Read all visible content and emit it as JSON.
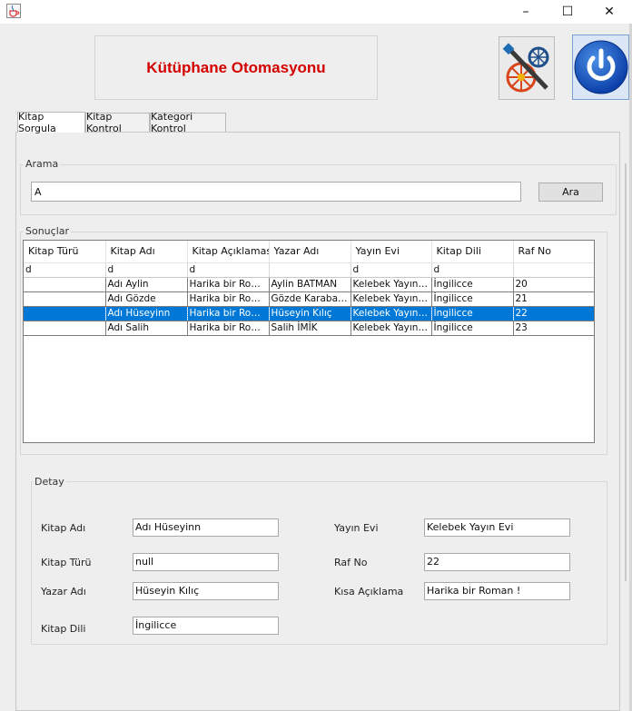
{
  "window": {
    "icon": "java-cup-icon",
    "controls": {
      "minimize": "–",
      "maximize": "☐",
      "close": "✕"
    }
  },
  "header": {
    "title": "Kütüphane Otomasyonu",
    "title_color": "#d40000",
    "tools_icon": "tools-wheel-icon",
    "power_icon": "power-icon"
  },
  "tabs": [
    {
      "label": "Kitap Sorgula",
      "active": true
    },
    {
      "label": "Kitap Kontrol",
      "active": false
    },
    {
      "label": "Kategori Kontrol",
      "active": false
    }
  ],
  "search": {
    "group_title": "Arama",
    "value": "A",
    "button_label": "Ara"
  },
  "results": {
    "group_title": "Sonuçlar",
    "columns": [
      "Kitap Türü",
      "Kitap Adı",
      "Kitap Açıklaması",
      "Yazar Adı",
      "Yayın Evi",
      "Kitap Dili",
      "Raf No"
    ],
    "filter_row": [
      "d",
      "d",
      "d",
      "",
      "d",
      "d",
      ""
    ],
    "rows": [
      {
        "cells": [
          "",
          "Adı Aylin",
          "Harika bir Roma...",
          "Aylin BATMAN",
          "Kelebek Yayın Evi",
          "İngilicce",
          "20"
        ],
        "selected": false
      },
      {
        "cells": [
          "",
          "Adı Gözde",
          "Harika bir Roma...",
          "Gözde Karabacak",
          "Kelebek Yayın Evi",
          "İngilicce",
          "21"
        ],
        "selected": false
      },
      {
        "cells": [
          "",
          "Adı Hüseyinn",
          "Harika bir Roma...",
          "Hüseyin Kılıç",
          "Kelebek Yayın Evi",
          "İngilicce",
          "22"
        ],
        "selected": true
      },
      {
        "cells": [
          "",
          "Adı Salih",
          "Harika bir Roma...",
          "Salih İMİK",
          "Kelebek Yayın Evi",
          "İngilicce",
          "23"
        ],
        "selected": false
      }
    ],
    "selection_color": "#0078d7"
  },
  "detail": {
    "group_title": "Detay",
    "kitap_adi": {
      "label": "Kitap Adı",
      "value": "Adı Hüseyinn"
    },
    "kitap_turu": {
      "label": "Kitap Türü",
      "value": "null"
    },
    "yazar_adi": {
      "label": "Yazar Adı",
      "value": "Hüseyin Kılıç"
    },
    "kitap_dili": {
      "label": "Kitap Dili",
      "value": "İngilicce"
    },
    "yayin_evi": {
      "label": "Yayın Evi",
      "value": "Kelebek Yayın Evi"
    },
    "raf_no": {
      "label": "Raf No",
      "value": "22"
    },
    "kisa_aciklama": {
      "label": "Kısa Açıklama",
      "value": "Harika bir Roman !"
    }
  }
}
